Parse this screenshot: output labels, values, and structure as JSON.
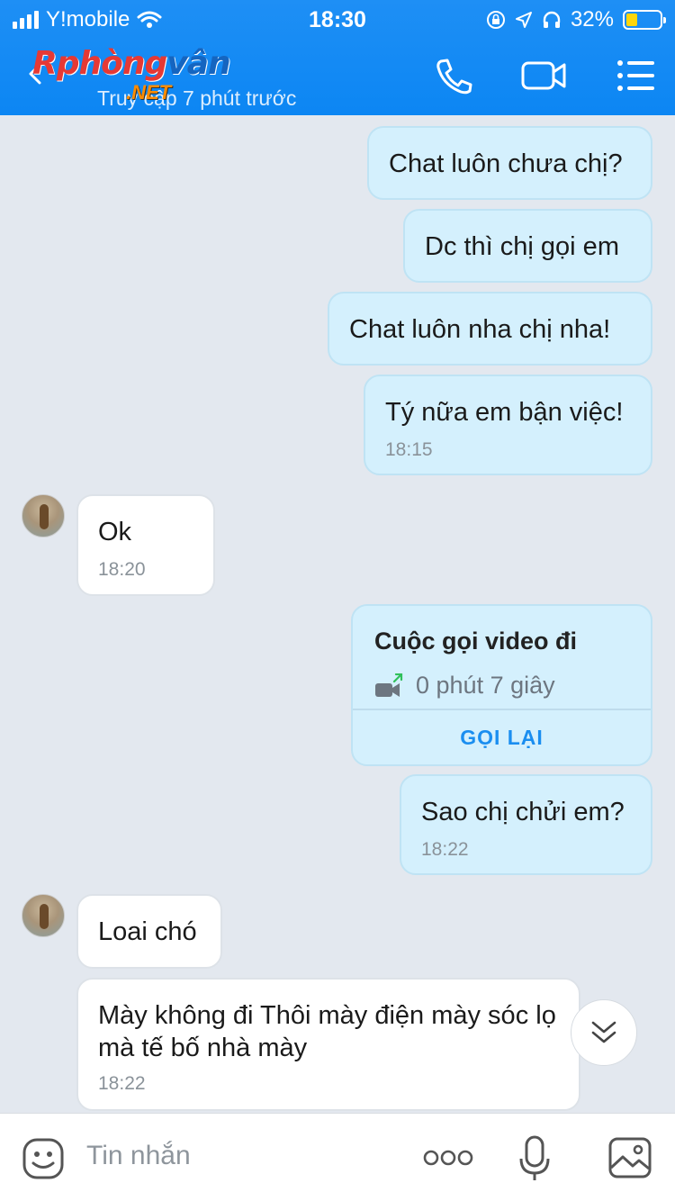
{
  "status_bar": {
    "carrier": "Y!mobile",
    "time": "18:30",
    "battery": "32%",
    "battery_level": 0.32,
    "colors": {
      "battery_fill": "#ffd60a"
    }
  },
  "header": {
    "logo_part1": "Rphòng",
    "logo_part2": "vân",
    "logo_net": ".NET",
    "subtitle": "Truy cập 7 phút trước",
    "icons": [
      "back-icon",
      "phone-icon",
      "video-camera-icon",
      "menu-icon"
    ],
    "colors": {
      "background": "#0c86f3"
    }
  },
  "messages": [
    {
      "id": "m1",
      "direction": "out",
      "text": "Chat luôn chưa chị?"
    },
    {
      "id": "m2",
      "direction": "out",
      "text": "Dc thì chị gọi em"
    },
    {
      "id": "m3",
      "direction": "out",
      "text": "Chat luôn nha chị nha!"
    },
    {
      "id": "m4",
      "direction": "out",
      "text": "Tý nữa em bận việc!",
      "time": "18:15"
    },
    {
      "id": "m5",
      "direction": "in",
      "text": "Ok",
      "time": "18:20"
    },
    {
      "id": "m6",
      "direction": "out",
      "type": "call",
      "title": "Cuộc gọi video đi",
      "duration": "0 phút 7 giây",
      "action": "GỌI LẠI"
    },
    {
      "id": "m7",
      "direction": "out",
      "text": "Sao chị chửi em?",
      "time": "18:22"
    },
    {
      "id": "m8",
      "direction": "in",
      "text": "Loai chó"
    },
    {
      "id": "m9",
      "direction": "in",
      "text": "Mày không đi Thôi mày điện mày sóc lọ mà tế bố nhà mày",
      "time": "18:22"
    }
  ],
  "composer": {
    "placeholder": "Tin nhắn",
    "icons": [
      "sticker-icon",
      "more-icon",
      "microphone-icon",
      "image-icon"
    ]
  },
  "colors": {
    "outgoing_bubble": "#d4f0fd",
    "incoming_bubble": "#ffffff",
    "chat_background": "#e3e8ef",
    "accent": "#1a8ef0"
  }
}
